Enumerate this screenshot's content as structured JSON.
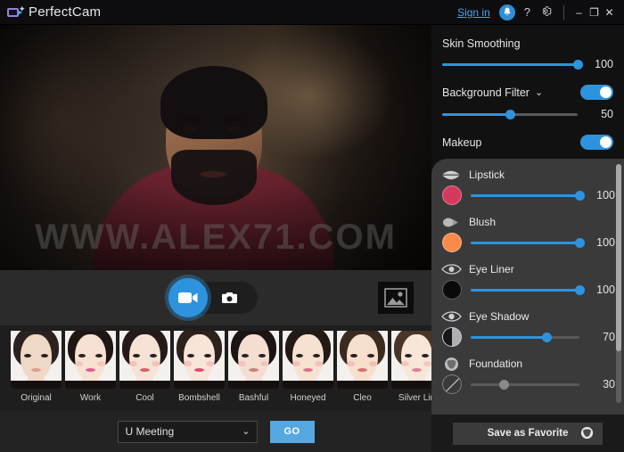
{
  "titlebar": {
    "app_title": "PerfectCam",
    "logo_icon": "perfectcam-logo-icon",
    "signin_label": "Sign in",
    "bell_icon": "notification-bell-icon",
    "help_label": "?",
    "settings_icon": "gear-icon",
    "minimize_label": "–",
    "maximize_label": "❐",
    "close_label": "✕"
  },
  "video": {
    "watermark": "WWW.ALEX71.COM"
  },
  "capture": {
    "video_icon": "video-camera-icon",
    "photo_icon": "photo-camera-icon",
    "gallery_icon": "gallery-image-icon"
  },
  "presets": [
    {
      "label": "Original",
      "hair": "#2b2220",
      "skin": "#f0d8c6",
      "lip": "#d99f90",
      "blush": "none"
    },
    {
      "label": "Work",
      "hair": "#1d1614",
      "skin": "#f6e1d2",
      "lip": "#e05f8c",
      "blush": "#f2b3a8"
    },
    {
      "label": "Cool",
      "hair": "#241b18",
      "skin": "#f7e3d6",
      "lip": "#d8626a",
      "blush": "#f0a9a0"
    },
    {
      "label": "Bombshell",
      "hair": "#2e201b",
      "skin": "#f8e4d8",
      "lip": "#e04a75",
      "blush": "#f2a8a4"
    },
    {
      "label": "Bashful",
      "hair": "#1a1413",
      "skin": "#f4ded2",
      "lip": "#c9807e",
      "blush": "#eeb0ae"
    },
    {
      "label": "Honeyed",
      "hair": "#231a16",
      "skin": "#f7e2d2",
      "lip": "#e0718c",
      "blush": "#f0a6a2"
    },
    {
      "label": "Cleo",
      "hair": "#3b2a20",
      "skin": "#f6dfcd",
      "lip": "#d96f76",
      "blush": "#eea8a0"
    },
    {
      "label": "Silver Lin",
      "hair": "#4a3528",
      "skin": "#f8e6d8",
      "lip": "#e37f96",
      "blush": "#f0aeaa"
    }
  ],
  "bottombar": {
    "meeting_value": "U Meeting",
    "meeting_chevron": "chevron-down-icon",
    "go_label": "GO"
  },
  "panel": {
    "skin_smoothing": {
      "label": "Skin Smoothing",
      "value": 100,
      "percent": 100
    },
    "background_filter": {
      "label": "Background Filter",
      "chevron": "chevron-down-icon",
      "enabled": true,
      "value": 50,
      "percent": 50
    },
    "makeup": {
      "label": "Makeup",
      "enabled": true
    },
    "makeup_items": [
      {
        "label": "Lipstick",
        "icon": "lips-icon",
        "swatch": "#d43a5c",
        "value": 100,
        "percent": 100,
        "enabled": true,
        "swatch_style": "solid"
      },
      {
        "label": "Blush",
        "icon": "blush-icon",
        "swatch": "#f98a4a",
        "value": 100,
        "percent": 100,
        "enabled": true,
        "swatch_style": "solid"
      },
      {
        "label": "Eye Liner",
        "icon": "eye-liner-icon",
        "swatch": "#0a0a0a",
        "value": 100,
        "percent": 100,
        "enabled": true,
        "swatch_style": "solid"
      },
      {
        "label": "Eye Shadow",
        "icon": "eye-shadow-icon",
        "swatch": "#b0aeb2",
        "value": 70,
        "percent": 70,
        "enabled": true,
        "swatch_style": "half"
      },
      {
        "label": "Foundation",
        "icon": "foundation-icon",
        "swatch": "#3a3a3a",
        "value": 30,
        "percent": 30,
        "enabled": false,
        "swatch_style": "none"
      }
    ],
    "favorite_button": {
      "label": "Save as Favorite",
      "icon": "face-icon"
    }
  },
  "colors": {
    "accent": "#2e93de",
    "link": "#4da3e8",
    "go_button": "#57a8e0",
    "panel_bg": "#111111",
    "makeup_panel_bg": "#3a3a3a"
  }
}
